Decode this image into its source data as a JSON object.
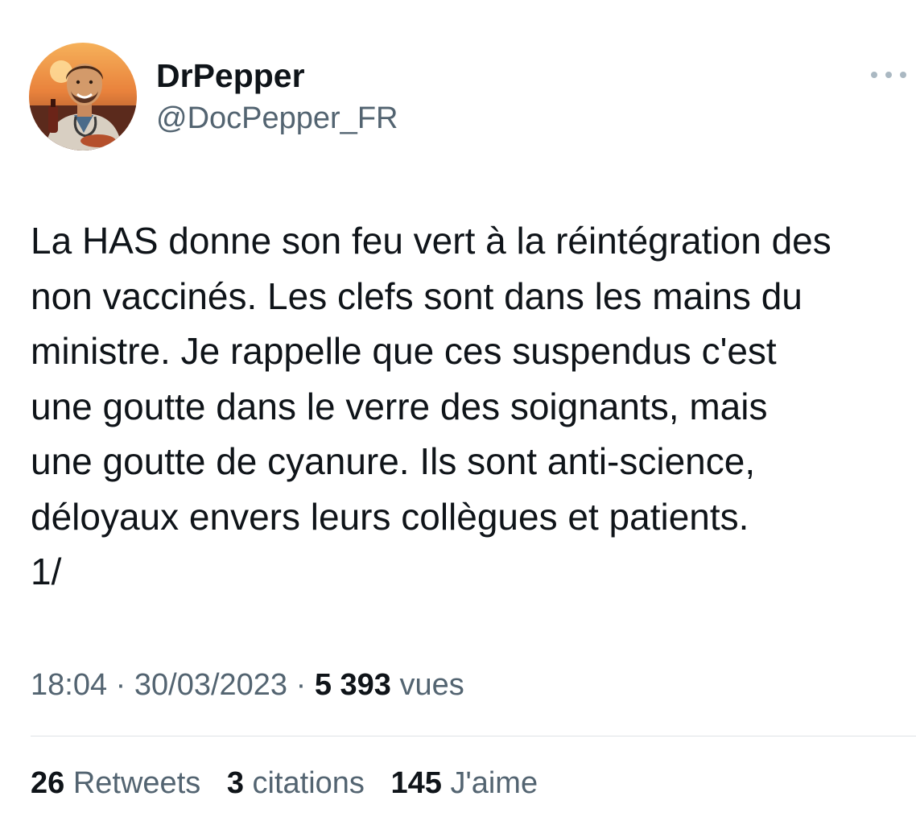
{
  "author": {
    "display_name": "DrPepper",
    "handle": "@DocPepper_FR",
    "avatar_icon": "doctor-avatar"
  },
  "more_icon": "more-horizontal-icon",
  "tweet": {
    "text": "La HAS donne son feu vert à la réintégration des\nnon vaccinés. Les clefs sont dans les mains du\nministre. Je rappelle que ces suspendus c'est\nune goutte dans le verre des soignants, mais\nune goutte de cyanure. Ils sont anti-science,\ndéloyaux envers leurs collègues et patients.\n1/"
  },
  "meta": {
    "time": "18:04",
    "separator": "·",
    "date": "30/03/2023",
    "views_count": "5 393",
    "views_label": "vues"
  },
  "stats": {
    "retweets_count": "26",
    "retweets_label": "Retweets",
    "quotes_count": "3",
    "quotes_label": "citations",
    "likes_count": "145",
    "likes_label": "J'aime"
  },
  "colors": {
    "text_primary": "#0f1419",
    "text_secondary": "#536471",
    "divider": "#dfe3e6"
  }
}
